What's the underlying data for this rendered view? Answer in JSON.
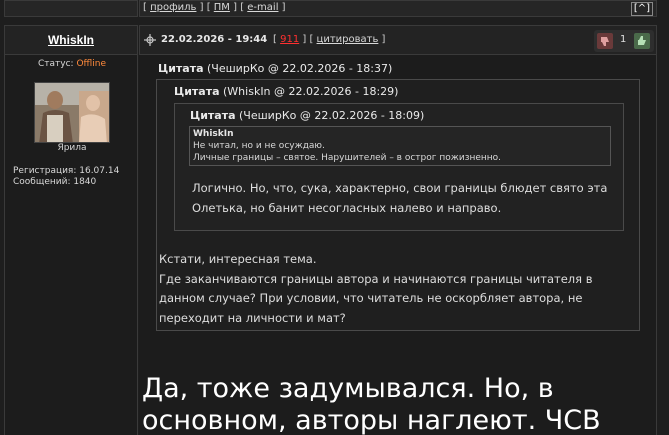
{
  "top_bar": {
    "link_profile": "профиль",
    "link_pm": "ПМ",
    "link_email": "e-mail",
    "to_top": "[^]"
  },
  "author": {
    "name": "WhiskIn",
    "status_label": "Статус:",
    "status_value": "Offline",
    "rank": "Ярила",
    "registration": "Регистрация: 16.07.14",
    "messages": "Сообщений: 1840"
  },
  "post": {
    "date": "22.02.2026 - 19:44",
    "reply_count": "911",
    "quote_label": "цитировать",
    "vote_count": "1",
    "quotes": {
      "outer_title_word": "Цитата",
      "outer_title_rest": "(ЧеширКо @ 22.02.2026 - 18:37)",
      "middle_title_word": "Цитата",
      "middle_title_rest": "(WhiskIn @ 22.02.2026 - 18:29)",
      "inner_title_word": "Цитата",
      "inner_title_rest": "(ЧеширКо @ 22.02.2026 - 18:09)",
      "inner_author": "WhiskIn",
      "inner_line1": "Не читал, но и не осуждаю.",
      "inner_line2": "Личные границы – святое. Нарушителей – в острог пожизненно.",
      "middle_text": "Логично. Но, что, сука, характерно, свои границы блюдет свято эта Олетька, но банит несогласных налево и направо.",
      "outer_text_1": "Кстати, интересная тема.",
      "outer_text_2": "Где заканчиваются границы автора и начинаются границы читателя в данном случае? При условии, что читатель не оскорбляет автора, не переходит на личности и мат?"
    },
    "body_text": "Да, тоже задумывался. Но, в основном, авторы наглеют. ЧСВ"
  },
  "colors": {
    "background": "#1c1c1c",
    "offline": "#ff8a3c",
    "reply_count": "#ff3030"
  }
}
